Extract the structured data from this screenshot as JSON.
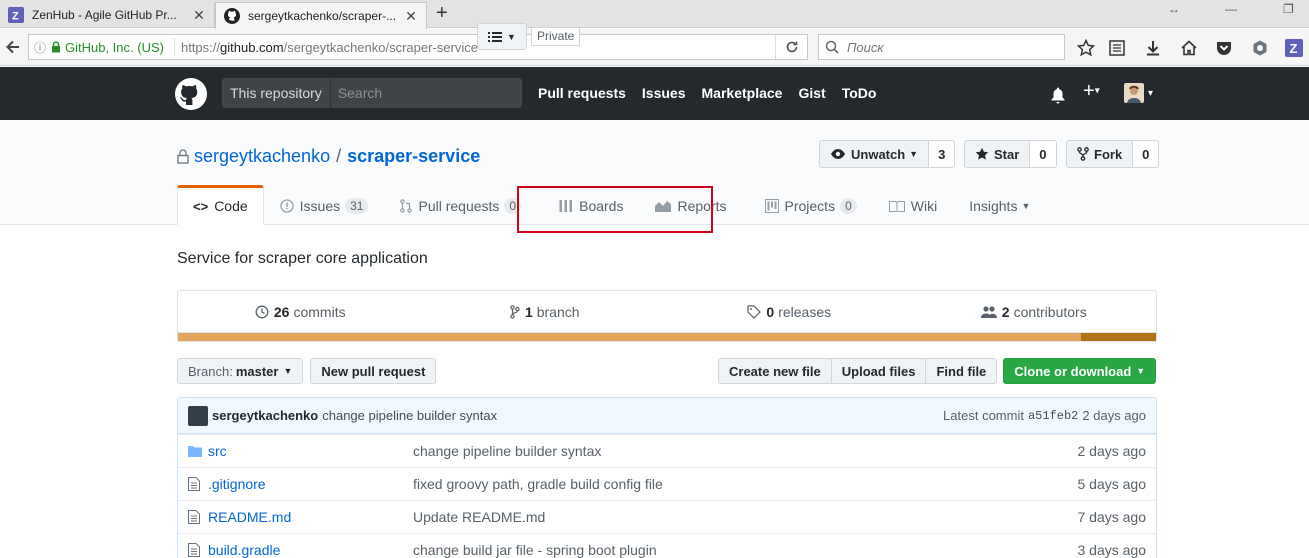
{
  "browser": {
    "tabs": [
      {
        "title": "ZenHub - Agile GitHub Pr...",
        "favicon": "zenhub-icon"
      },
      {
        "title": "sergeytkachenko/scraper-...",
        "favicon": "github-icon"
      }
    ],
    "url": {
      "site_identity": "GitHub, Inc. (US)",
      "protocol": "https://",
      "host": "github.com",
      "path": "/sergeytkachenko/scraper-service"
    },
    "search_placeholder": "Поиск"
  },
  "github_header": {
    "scope_label": "This repository",
    "search_placeholder": "Search",
    "nav": [
      "Pull requests",
      "Issues",
      "Marketplace",
      "Gist",
      "ToDo"
    ]
  },
  "repo": {
    "owner": "sergeytkachenko",
    "separator": "/",
    "name": "scraper-service",
    "visibility": "Private",
    "actions": {
      "watch": {
        "label": "Unwatch",
        "count": "3"
      },
      "star": {
        "label": "Star",
        "count": "0"
      },
      "fork": {
        "label": "Fork",
        "count": "0"
      }
    },
    "tabs": {
      "code": "Code",
      "issues": {
        "label": "Issues",
        "count": "31"
      },
      "pulls": {
        "label": "Pull requests",
        "count": "0"
      },
      "boards": "Boards",
      "reports": "Reports",
      "projects": {
        "label": "Projects",
        "count": "0"
      },
      "wiki": "Wiki",
      "insights": "Insights"
    },
    "description": "Service for scraper core application"
  },
  "summary": {
    "commits": {
      "count": "26",
      "label": "commits"
    },
    "branches": {
      "count": "1",
      "label": "branch"
    },
    "releases": {
      "count": "0",
      "label": "releases"
    },
    "contributors": {
      "count": "2",
      "label": "contributors"
    },
    "language_colors": [
      "#e3a35a",
      "#b07219"
    ]
  },
  "filebar": {
    "branch_label": "Branch:",
    "branch": "master",
    "new_pr": "New pull request",
    "create_file": "Create new file",
    "upload_files": "Upload files",
    "find_file": "Find file",
    "clone": "Clone or download"
  },
  "latest_commit": {
    "author": "sergeytkachenko",
    "message": "change pipeline builder syntax",
    "label": "Latest commit",
    "sha": "a51feb2",
    "age": "2 days ago"
  },
  "files": [
    {
      "type": "folder-icon",
      "name": "src",
      "message": "change pipeline builder syntax",
      "age": "2 days ago"
    },
    {
      "type": "file-icon",
      "name": ".gitignore",
      "message": "fixed groovy path, gradle build config file",
      "age": "5 days ago"
    },
    {
      "type": "file-icon",
      "name": "README.md",
      "message": "Update README.md",
      "age": "7 days ago"
    },
    {
      "type": "file-icon",
      "name": "build.gradle",
      "message": "change build jar file - spring boot plugin",
      "age": "3 days ago"
    }
  ],
  "colors": {
    "gh_header": "#24292e",
    "link": "#0366d6",
    "tab_accent": "#e36209",
    "highlight": "#d0021b",
    "clone_button": "#28a745"
  }
}
